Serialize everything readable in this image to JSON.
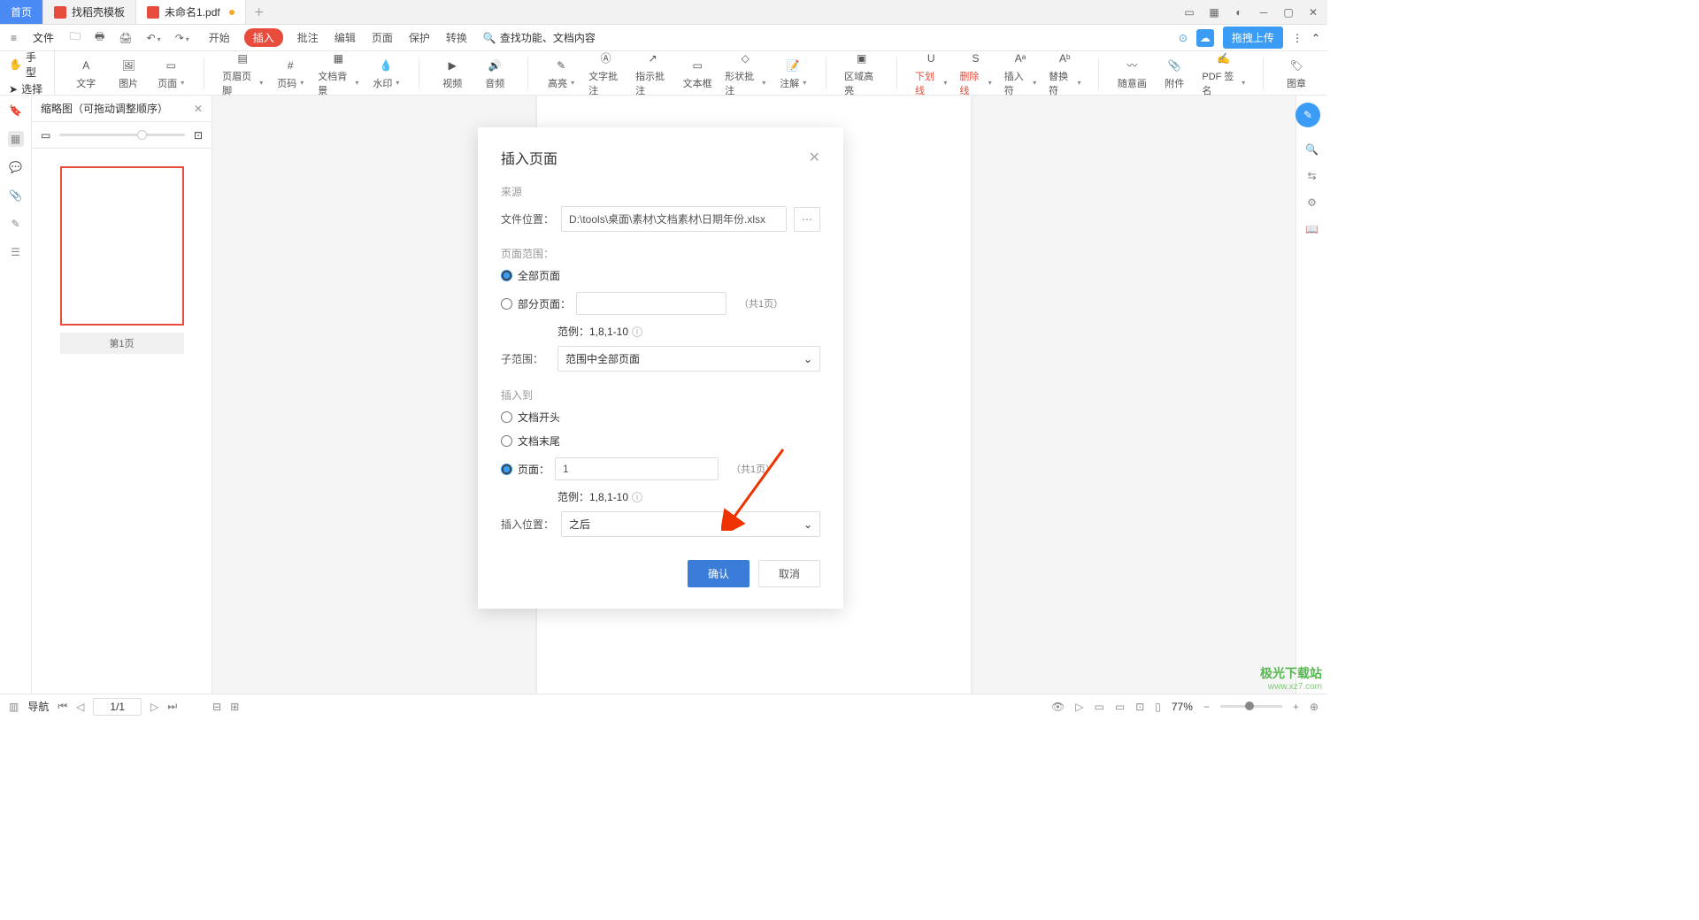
{
  "tabs": {
    "home": "首页",
    "template": "找稻壳模板",
    "doc": "未命名1.pdf"
  },
  "menubar": {
    "file": "文件",
    "tabs": [
      "开始",
      "插入",
      "批注",
      "编辑",
      "页面",
      "保护",
      "转换"
    ],
    "active_idx": 1,
    "search_placeholder": "查找功能、文档内容",
    "upload": "拖拽上传"
  },
  "mode": {
    "hand": "手型",
    "select": "选择"
  },
  "ribbon": [
    {
      "n": "text-tool",
      "l": "文字"
    },
    {
      "n": "image-tool",
      "l": "图片"
    },
    {
      "n": "page-tool",
      "l": "页面",
      "d": 1
    },
    {
      "sep": 1
    },
    {
      "n": "header-footer",
      "l": "页眉页脚",
      "d": 1
    },
    {
      "n": "page-number",
      "l": "页码",
      "d": 1
    },
    {
      "n": "bg",
      "l": "文档背景",
      "d": 1
    },
    {
      "n": "watermark",
      "l": "水印",
      "d": 1
    },
    {
      "sep": 1
    },
    {
      "n": "video",
      "l": "视频"
    },
    {
      "n": "audio",
      "l": "音频"
    },
    {
      "sep": 1
    },
    {
      "n": "highlight",
      "l": "高亮",
      "d": 1
    },
    {
      "n": "text-annot",
      "l": "文字批注"
    },
    {
      "n": "instruct-annot",
      "l": "指示批注"
    },
    {
      "n": "textbox",
      "l": "文本框"
    },
    {
      "n": "shape-annot",
      "l": "形状批注",
      "d": 1
    },
    {
      "n": "note",
      "l": "注解",
      "d": 1
    },
    {
      "sep": 1
    },
    {
      "n": "area-hl",
      "l": "区域高亮"
    },
    {
      "sep": 1
    },
    {
      "n": "underline",
      "l": "下划线",
      "red": 1,
      "d": 1
    },
    {
      "n": "strike",
      "l": "删除线",
      "red": 1,
      "d": 1
    },
    {
      "n": "insert-char",
      "l": "插入符",
      "d": 1
    },
    {
      "n": "replace-char",
      "l": "替换符",
      "d": 1
    },
    {
      "sep": 1
    },
    {
      "n": "freehand",
      "l": "随意画"
    },
    {
      "n": "attachment",
      "l": "附件"
    },
    {
      "n": "pdf-sign",
      "l": "PDF 签名",
      "d": 1
    },
    {
      "sep": 1
    },
    {
      "n": "stamp",
      "l": "图章"
    }
  ],
  "thumb": {
    "title": "缩略图（可拖动调整顺序）",
    "page1": "第1页"
  },
  "dialog": {
    "title": "插入页面",
    "source": "来源",
    "file_loc": "文件位置：",
    "file_path": "D:\\tools\\桌面\\素材\\文档素材\\日期年份.xlsx",
    "page_range": "页面范围：",
    "all_pages": "全部页面",
    "part_pages": "部分页面：",
    "total1": "（共1页）",
    "example": "范例：1,8,1-10",
    "subrange": "子范围：",
    "subrange_val": "范围中全部页面",
    "insert_to": "插入到",
    "doc_start": "文档开头",
    "doc_end": "文档末尾",
    "page": "页面：",
    "page_val": "1",
    "total2": "（共1页）",
    "insert_pos": "插入位置：",
    "pos_val": "之后",
    "ok": "确认",
    "cancel": "取消"
  },
  "status": {
    "nav": "导航",
    "page": "1/1",
    "zoom": "77%"
  },
  "watermark": {
    "l1": "极光下载站",
    "l2": "www.xz7.com"
  }
}
